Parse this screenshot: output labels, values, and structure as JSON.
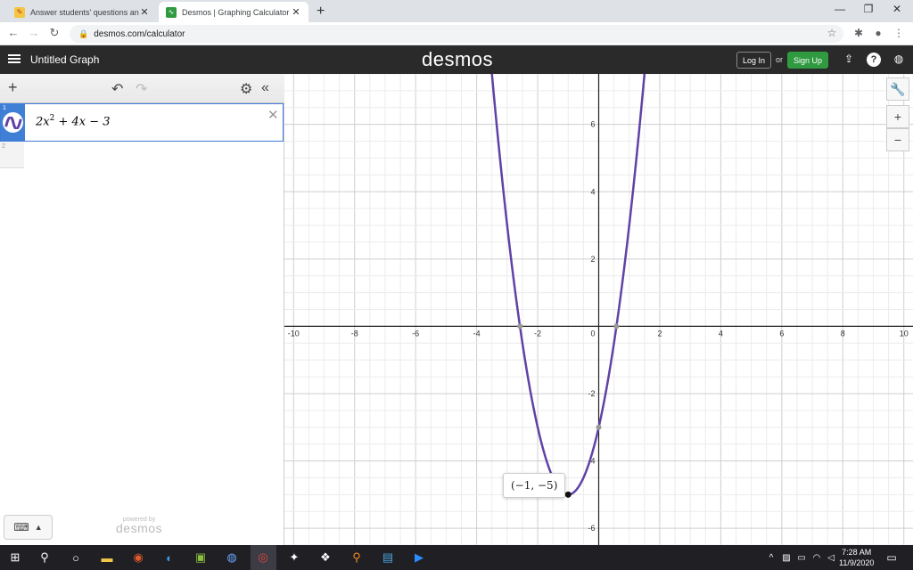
{
  "browser": {
    "tabs": [
      {
        "title": "Answer students' questions and e",
        "active": false
      },
      {
        "title": "Desmos | Graphing Calculator",
        "active": true
      }
    ],
    "url": "desmos.com/calculator"
  },
  "header": {
    "graph_title": "Untitled Graph",
    "logo": "desmos",
    "login_label": "Log In",
    "or_label": "or",
    "signup_label": "Sign Up"
  },
  "expressions": {
    "items": [
      {
        "index": "1",
        "latex_parts": [
          "2x",
          "2",
          " + 4x − 3"
        ],
        "color": "#6042a6"
      },
      {
        "index": "2"
      }
    ]
  },
  "powered_by": {
    "small": "powered by",
    "brand": "desmos"
  },
  "graph": {
    "xmin": -10.3,
    "xmax": 10.3,
    "ymin": -6.5,
    "ymax": 7.5,
    "x_ticks": [
      "-10",
      "-8",
      "-6",
      "-4",
      "-2",
      "2",
      "4",
      "6",
      "8",
      "10"
    ],
    "y_ticks": [
      "6",
      "4",
      "2",
      "-2",
      "-4",
      "-6"
    ],
    "origin_label": "0",
    "curve": {
      "a": 2,
      "b": 4,
      "c": -3,
      "color": "#6042a6"
    },
    "vertex": {
      "x": -1,
      "y": -5,
      "label": "(−1, −5)"
    },
    "roots": [
      -2.58,
      0.58
    ],
    "y_intercept": -3
  },
  "taskbar": {
    "time": "7:28 AM",
    "date": "11/9/2020"
  },
  "colors": {
    "header_bg": "#2a2a2a",
    "signup_green": "#2f9a3f",
    "expr_tab_blue": "#3f7fd6",
    "curve_purple": "#6042a6"
  }
}
